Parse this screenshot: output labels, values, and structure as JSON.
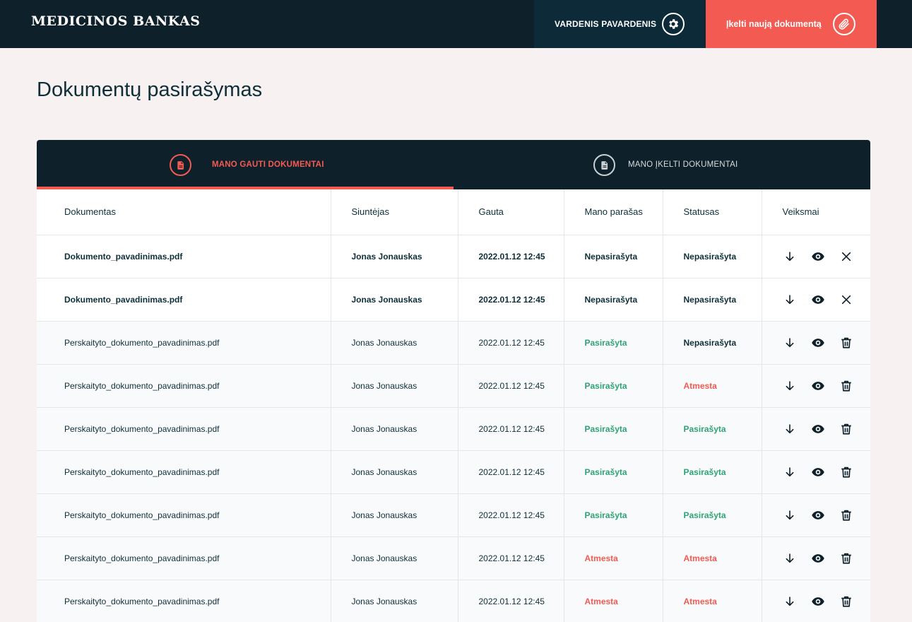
{
  "header": {
    "logo": "MEDICINOS BANKAS",
    "user_name": "VARDENIS PAVARDENIS",
    "upload_label": "Įkelti naują dokumentą"
  },
  "page": {
    "title": "Dokumentų pasirašymas"
  },
  "tabs": [
    {
      "label": "MANO GAUTI DOKUMENTAI",
      "active": true
    },
    {
      "label": "MANO ĮKELTI DOKUMENTAI",
      "active": false
    }
  ],
  "table": {
    "columns": [
      "Dokumentas",
      "Siuntėjas",
      "Gauta",
      "Mano parašas",
      "Statusas",
      "Veiksmai"
    ],
    "rows": [
      {
        "document": "Dokumento_pavadinimas.pdf",
        "sender": "Jonas Jonauskas",
        "received": "2022.01.12 12:45",
        "my_signature": "Nepasirašyta",
        "status": "Nepasirašyta",
        "unread": true
      },
      {
        "document": "Dokumento_pavadinimas.pdf",
        "sender": "Jonas Jonauskas",
        "received": "2022.01.12 12:45",
        "my_signature": "Nepasirašyta",
        "status": "Nepasirašyta",
        "unread": true
      },
      {
        "document": "Perskaityto_dokumento_pavadinimas.pdf",
        "sender": "Jonas Jonauskas",
        "received": "2022.01.12 12:45",
        "my_signature": "Pasirašyta",
        "status": "Nepasirašyta",
        "unread": false
      },
      {
        "document": "Perskaityto_dokumento_pavadinimas.pdf",
        "sender": "Jonas Jonauskas",
        "received": "2022.01.12 12:45",
        "my_signature": "Pasirašyta",
        "status": "Atmesta",
        "unread": false
      },
      {
        "document": "Perskaityto_dokumento_pavadinimas.pdf",
        "sender": "Jonas Jonauskas",
        "received": "2022.01.12 12:45",
        "my_signature": "Pasirašyta",
        "status": "Pasirašyta",
        "unread": false
      },
      {
        "document": "Perskaityto_dokumento_pavadinimas.pdf",
        "sender": "Jonas Jonauskas",
        "received": "2022.01.12 12:45",
        "my_signature": "Pasirašyta",
        "status": "Pasirašyta",
        "unread": false
      },
      {
        "document": "Perskaityto_dokumento_pavadinimas.pdf",
        "sender": "Jonas Jonauskas",
        "received": "2022.01.12 12:45",
        "my_signature": "Pasirašyta",
        "status": "Pasirašyta",
        "unread": false
      },
      {
        "document": "Perskaityto_dokumento_pavadinimas.pdf",
        "sender": "Jonas Jonauskas",
        "received": "2022.01.12 12:45",
        "my_signature": "Atmesta",
        "status": "Atmesta",
        "unread": false
      },
      {
        "document": "Perskaityto_dokumento_pavadinimas.pdf",
        "sender": "Jonas Jonauskas",
        "received": "2022.01.12 12:45",
        "my_signature": "Atmesta",
        "status": "Atmesta",
        "unread": false
      }
    ]
  },
  "icons": {
    "settings": "gear-icon",
    "upload": "paperclip-icon",
    "tab_document": "document-icon",
    "download": "download-arrow-icon",
    "view": "eye-icon",
    "reject": "close-icon",
    "delete": "trash-icon"
  },
  "colors": {
    "navy": "#0e212b",
    "accent": "#f35a52",
    "signed": "#2ea374",
    "rejected": "#f35a52",
    "background": "#f8f1f2"
  }
}
